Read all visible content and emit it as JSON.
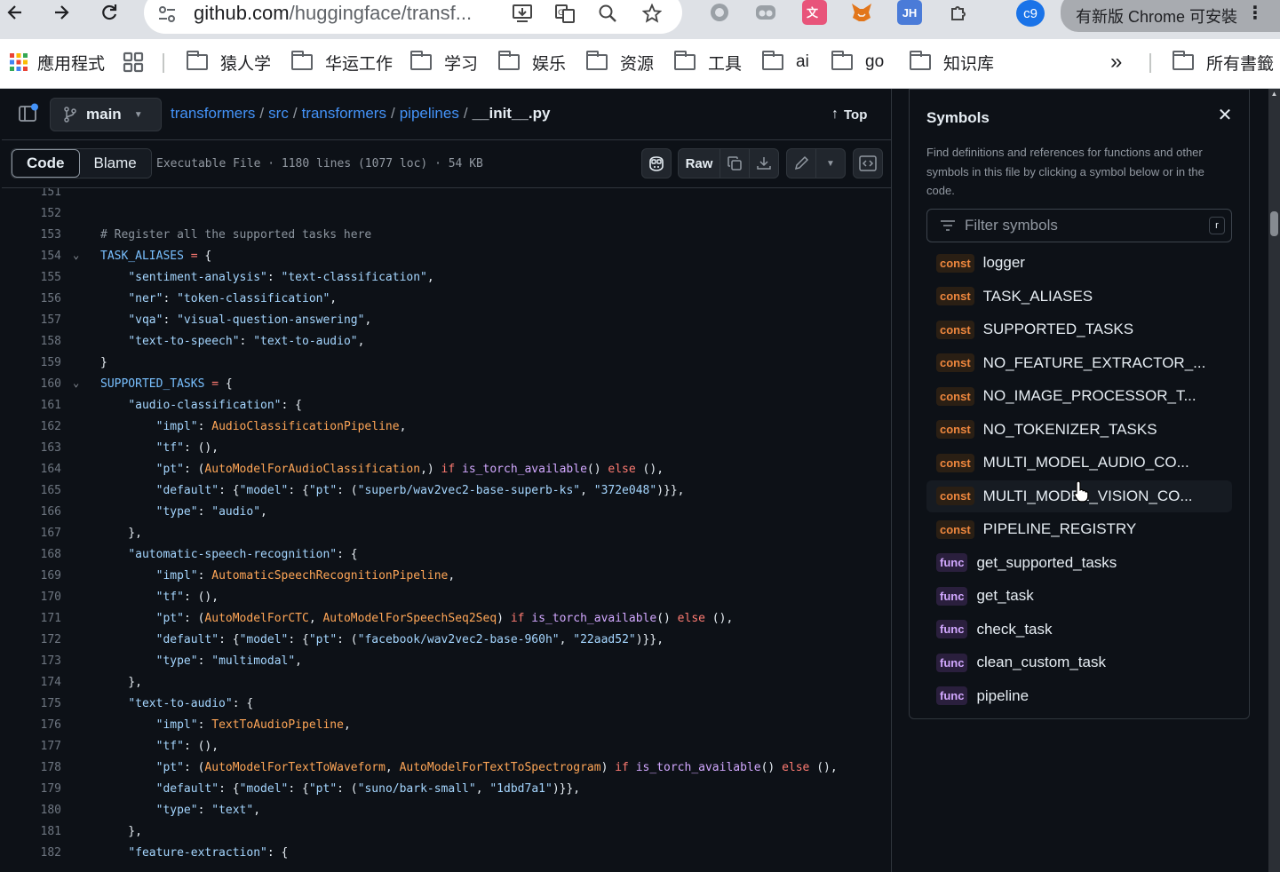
{
  "browser": {
    "url_host": "github.com",
    "url_path": "/huggingface/transf...",
    "profile_initials": "c9",
    "update_label": "有新版 Chrome 可安裝",
    "ext_jh": "JH"
  },
  "bookmarks": {
    "apps_label": "應用程式",
    "folders": [
      "猿人学",
      "华运工作",
      "学习",
      "娱乐",
      "资源",
      "工具",
      "ai",
      "go",
      "知识库"
    ],
    "overflow": "»",
    "all_bookmarks": "所有書籤"
  },
  "repo": {
    "branch": "main",
    "crumbs": [
      "transformers",
      "src",
      "transformers",
      "pipelines"
    ],
    "file": "__init__.py",
    "top_label": "Top"
  },
  "toolbar": {
    "code_tab": "Code",
    "blame_tab": "Blame",
    "meta": "Executable File · 1180 lines (1077 loc) · 54 KB",
    "raw_label": "Raw"
  },
  "symbols": {
    "title": "Symbols",
    "description": "Find definitions and references for functions and other symbols in this file by clicking a symbol below or in the code.",
    "filter_placeholder": "Filter symbols",
    "shortcut": "r",
    "items": [
      {
        "kind": "const",
        "name": "logger"
      },
      {
        "kind": "const",
        "name": "TASK_ALIASES"
      },
      {
        "kind": "const",
        "name": "SUPPORTED_TASKS"
      },
      {
        "kind": "const",
        "name": "NO_FEATURE_EXTRACTOR_..."
      },
      {
        "kind": "const",
        "name": "NO_IMAGE_PROCESSOR_T..."
      },
      {
        "kind": "const",
        "name": "NO_TOKENIZER_TASKS"
      },
      {
        "kind": "const",
        "name": "MULTI_MODEL_AUDIO_CO..."
      },
      {
        "kind": "const",
        "name": "MULTI_MODEL_VISION_CO..."
      },
      {
        "kind": "const",
        "name": "PIPELINE_REGISTRY"
      },
      {
        "kind": "func",
        "name": "get_supported_tasks"
      },
      {
        "kind": "func",
        "name": "get_task"
      },
      {
        "kind": "func",
        "name": "check_task"
      },
      {
        "kind": "func",
        "name": "clean_custom_task"
      },
      {
        "kind": "func",
        "name": "pipeline"
      }
    ]
  },
  "code_lines": [
    {
      "n": "151",
      "fold": false,
      "tokens": []
    },
    {
      "n": "152",
      "fold": false,
      "tokens": []
    },
    {
      "n": "153",
      "fold": false,
      "tokens": [
        [
          "cm",
          "# Register all the supported tasks here"
        ]
      ]
    },
    {
      "n": "154",
      "fold": true,
      "tokens": [
        [
          "const",
          "TASK_ALIASES"
        ],
        [
          "p",
          " "
        ],
        [
          "op",
          "="
        ],
        [
          "p",
          " {"
        ]
      ]
    },
    {
      "n": "155",
      "fold": false,
      "tokens": [
        [
          "p",
          "    "
        ],
        [
          "str",
          "\"sentiment-analysis\""
        ],
        [
          "p",
          ": "
        ],
        [
          "str",
          "\"text-classification\""
        ],
        [
          "p",
          ","
        ]
      ]
    },
    {
      "n": "156",
      "fold": false,
      "tokens": [
        [
          "p",
          "    "
        ],
        [
          "str",
          "\"ner\""
        ],
        [
          "p",
          ": "
        ],
        [
          "str",
          "\"token-classification\""
        ],
        [
          "p",
          ","
        ]
      ]
    },
    {
      "n": "157",
      "fold": false,
      "tokens": [
        [
          "p",
          "    "
        ],
        [
          "str",
          "\"vqa\""
        ],
        [
          "p",
          ": "
        ],
        [
          "str",
          "\"visual-question-answering\""
        ],
        [
          "p",
          ","
        ]
      ]
    },
    {
      "n": "158",
      "fold": false,
      "tokens": [
        [
          "p",
          "    "
        ],
        [
          "str",
          "\"text-to-speech\""
        ],
        [
          "p",
          ": "
        ],
        [
          "str",
          "\"text-to-audio\""
        ],
        [
          "p",
          ","
        ]
      ]
    },
    {
      "n": "159",
      "fold": false,
      "tokens": [
        [
          "p",
          "}"
        ]
      ]
    },
    {
      "n": "160",
      "fold": true,
      "tokens": [
        [
          "const",
          "SUPPORTED_TASKS"
        ],
        [
          "p",
          " "
        ],
        [
          "op",
          "="
        ],
        [
          "p",
          " {"
        ]
      ]
    },
    {
      "n": "161",
      "fold": false,
      "tokens": [
        [
          "p",
          "    "
        ],
        [
          "str",
          "\"audio-classification\""
        ],
        [
          "p",
          ": {"
        ]
      ]
    },
    {
      "n": "162",
      "fold": false,
      "tokens": [
        [
          "p",
          "        "
        ],
        [
          "str",
          "\"impl\""
        ],
        [
          "p",
          ": "
        ],
        [
          "cls",
          "AudioClassificationPipeline"
        ],
        [
          "p",
          ","
        ]
      ]
    },
    {
      "n": "163",
      "fold": false,
      "tokens": [
        [
          "p",
          "        "
        ],
        [
          "str",
          "\"tf\""
        ],
        [
          "p",
          ": (),"
        ]
      ]
    },
    {
      "n": "164",
      "fold": false,
      "tokens": [
        [
          "p",
          "        "
        ],
        [
          "str",
          "\"pt\""
        ],
        [
          "p",
          ": ("
        ],
        [
          "cls",
          "AutoModelForAudioClassification"
        ],
        [
          "p",
          ",) "
        ],
        [
          "kw",
          "if"
        ],
        [
          "p",
          " "
        ],
        [
          "fn",
          "is_torch_available"
        ],
        [
          "p",
          "() "
        ],
        [
          "kw",
          "else"
        ],
        [
          "p",
          " (),"
        ]
      ]
    },
    {
      "n": "165",
      "fold": false,
      "tokens": [
        [
          "p",
          "        "
        ],
        [
          "str",
          "\"default\""
        ],
        [
          "p",
          ": {"
        ],
        [
          "str",
          "\"model\""
        ],
        [
          "p",
          ": {"
        ],
        [
          "str",
          "\"pt\""
        ],
        [
          "p",
          ": ("
        ],
        [
          "str",
          "\"superb/wav2vec2-base-superb-ks\""
        ],
        [
          "p",
          ", "
        ],
        [
          "str",
          "\"372e048\""
        ],
        [
          "p",
          ")}},"
        ]
      ]
    },
    {
      "n": "166",
      "fold": false,
      "tokens": [
        [
          "p",
          "        "
        ],
        [
          "str",
          "\"type\""
        ],
        [
          "p",
          ": "
        ],
        [
          "str",
          "\"audio\""
        ],
        [
          "p",
          ","
        ]
      ]
    },
    {
      "n": "167",
      "fold": false,
      "tokens": [
        [
          "p",
          "    },"
        ]
      ]
    },
    {
      "n": "168",
      "fold": false,
      "tokens": [
        [
          "p",
          "    "
        ],
        [
          "str",
          "\"automatic-speech-recognition\""
        ],
        [
          "p",
          ": {"
        ]
      ]
    },
    {
      "n": "169",
      "fold": false,
      "tokens": [
        [
          "p",
          "        "
        ],
        [
          "str",
          "\"impl\""
        ],
        [
          "p",
          ": "
        ],
        [
          "cls",
          "AutomaticSpeechRecognitionPipeline"
        ],
        [
          "p",
          ","
        ]
      ]
    },
    {
      "n": "170",
      "fold": false,
      "tokens": [
        [
          "p",
          "        "
        ],
        [
          "str",
          "\"tf\""
        ],
        [
          "p",
          ": (),"
        ]
      ]
    },
    {
      "n": "171",
      "fold": false,
      "tokens": [
        [
          "p",
          "        "
        ],
        [
          "str",
          "\"pt\""
        ],
        [
          "p",
          ": ("
        ],
        [
          "cls",
          "AutoModelForCTC"
        ],
        [
          "p",
          ", "
        ],
        [
          "cls",
          "AutoModelForSpeechSeq2Seq"
        ],
        [
          "p",
          ") "
        ],
        [
          "kw",
          "if"
        ],
        [
          "p",
          " "
        ],
        [
          "fn",
          "is_torch_available"
        ],
        [
          "p",
          "() "
        ],
        [
          "kw",
          "else"
        ],
        [
          "p",
          " (),"
        ]
      ]
    },
    {
      "n": "172",
      "fold": false,
      "tokens": [
        [
          "p",
          "        "
        ],
        [
          "str",
          "\"default\""
        ],
        [
          "p",
          ": {"
        ],
        [
          "str",
          "\"model\""
        ],
        [
          "p",
          ": {"
        ],
        [
          "str",
          "\"pt\""
        ],
        [
          "p",
          ": ("
        ],
        [
          "str",
          "\"facebook/wav2vec2-base-960h\""
        ],
        [
          "p",
          ", "
        ],
        [
          "str",
          "\"22aad52\""
        ],
        [
          "p",
          ")}},"
        ]
      ]
    },
    {
      "n": "173",
      "fold": false,
      "tokens": [
        [
          "p",
          "        "
        ],
        [
          "str",
          "\"type\""
        ],
        [
          "p",
          ": "
        ],
        [
          "str",
          "\"multimodal\""
        ],
        [
          "p",
          ","
        ]
      ]
    },
    {
      "n": "174",
      "fold": false,
      "tokens": [
        [
          "p",
          "    },"
        ]
      ]
    },
    {
      "n": "175",
      "fold": false,
      "tokens": [
        [
          "p",
          "    "
        ],
        [
          "str",
          "\"text-to-audio\""
        ],
        [
          "p",
          ": {"
        ]
      ]
    },
    {
      "n": "176",
      "fold": false,
      "tokens": [
        [
          "p",
          "        "
        ],
        [
          "str",
          "\"impl\""
        ],
        [
          "p",
          ": "
        ],
        [
          "cls",
          "TextToAudioPipeline"
        ],
        [
          "p",
          ","
        ]
      ]
    },
    {
      "n": "177",
      "fold": false,
      "tokens": [
        [
          "p",
          "        "
        ],
        [
          "str",
          "\"tf\""
        ],
        [
          "p",
          ": (),"
        ]
      ]
    },
    {
      "n": "178",
      "fold": false,
      "tokens": [
        [
          "p",
          "        "
        ],
        [
          "str",
          "\"pt\""
        ],
        [
          "p",
          ": ("
        ],
        [
          "cls",
          "AutoModelForTextToWaveform"
        ],
        [
          "p",
          ", "
        ],
        [
          "cls",
          "AutoModelForTextToSpectrogram"
        ],
        [
          "p",
          ") "
        ],
        [
          "kw",
          "if"
        ],
        [
          "p",
          " "
        ],
        [
          "fn",
          "is_torch_available"
        ],
        [
          "p",
          "() "
        ],
        [
          "kw",
          "else"
        ],
        [
          "p",
          " (),"
        ]
      ]
    },
    {
      "n": "179",
      "fold": false,
      "tokens": [
        [
          "p",
          "        "
        ],
        [
          "str",
          "\"default\""
        ],
        [
          "p",
          ": {"
        ],
        [
          "str",
          "\"model\""
        ],
        [
          "p",
          ": {"
        ],
        [
          "str",
          "\"pt\""
        ],
        [
          "p",
          ": ("
        ],
        [
          "str",
          "\"suno/bark-small\""
        ],
        [
          "p",
          ", "
        ],
        [
          "str",
          "\"1dbd7a1\""
        ],
        [
          "p",
          ")}},"
        ]
      ]
    },
    {
      "n": "180",
      "fold": false,
      "tokens": [
        [
          "p",
          "        "
        ],
        [
          "str",
          "\"type\""
        ],
        [
          "p",
          ": "
        ],
        [
          "str",
          "\"text\""
        ],
        [
          "p",
          ","
        ]
      ]
    },
    {
      "n": "181",
      "fold": false,
      "tokens": [
        [
          "p",
          "    },"
        ]
      ]
    },
    {
      "n": "182",
      "fold": false,
      "tokens": [
        [
          "p",
          "    "
        ],
        [
          "str",
          "\"feature-extraction\""
        ],
        [
          "p",
          ": {"
        ]
      ]
    }
  ],
  "colors": {
    "link": "#4493f8",
    "const_badge": "#f0883e",
    "func_badge": "#d2a8ff"
  }
}
